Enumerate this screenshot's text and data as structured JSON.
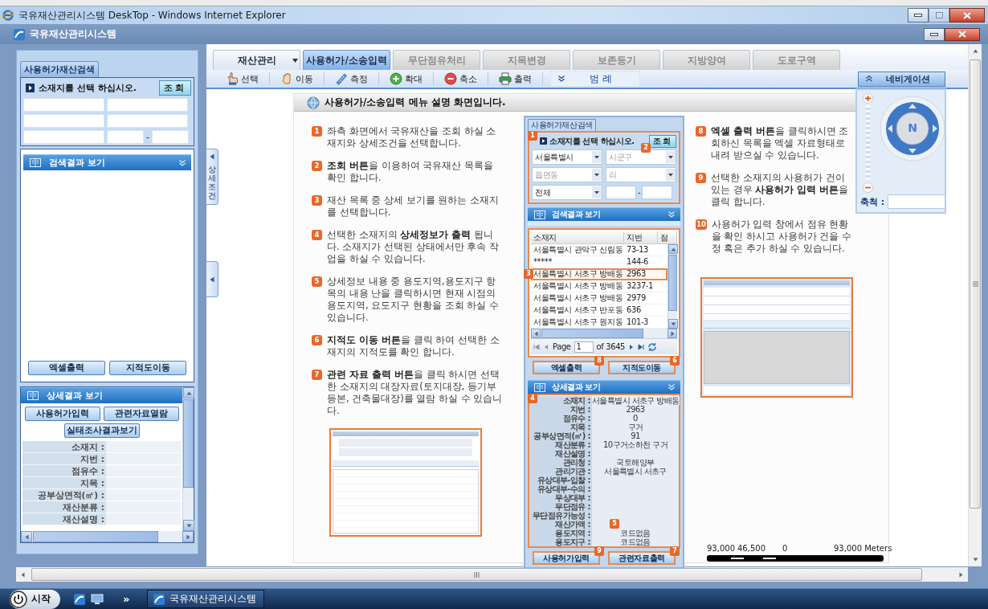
{
  "window": {
    "title": "국유재산관리시스템 DeskTop - Windows Internet Explorer"
  },
  "app": {
    "title": "국유재산관리시스템"
  },
  "search_panel": {
    "tabs": [
      {
        "label": "사용허가재산검색",
        "selected": true
      }
    ],
    "prompt": "소재지를 선택 하십시오.",
    "search_button": "조회",
    "range_separator": "-"
  },
  "results_section": {
    "title": "검색결과 보기",
    "buttons": [
      "엑셀출력",
      "지적도이동"
    ]
  },
  "detail_section": {
    "title": "상세결과 보기",
    "buttons": [
      "사용허가입력",
      "관련자료열람",
      "실태조사결과보기"
    ],
    "fields": [
      "소재지 :",
      "지번 :",
      "점유수 :",
      "지목 :",
      "공부상면적(㎡) :",
      "재산분류 :",
      "재산설명 :"
    ]
  },
  "side_handles": [
    {
      "kind": "labeled",
      "label": "상세조건"
    },
    {
      "kind": "arrow"
    }
  ],
  "tabs": [
    {
      "label": "재산관리",
      "selected": false,
      "disabled": false,
      "dropdown": true
    },
    {
      "label": "사용허가/소송입력",
      "selected": true,
      "disabled": false,
      "dropdown": false
    },
    {
      "label": "무단점유처리",
      "selected": false,
      "disabled": true,
      "dropdown": false
    },
    {
      "label": "지목변경",
      "selected": false,
      "disabled": true,
      "dropdown": false
    },
    {
      "label": "보존등기",
      "selected": false,
      "disabled": true,
      "dropdown": false
    },
    {
      "label": "지방양여",
      "selected": false,
      "disabled": true,
      "dropdown": false
    },
    {
      "label": "도로구역",
      "selected": false,
      "disabled": true,
      "dropdown": false
    }
  ],
  "toolbar": [
    {
      "kind": "select",
      "label": "선택"
    },
    {
      "kind": "pan",
      "label": "이동"
    },
    {
      "kind": "measure",
      "label": "측정"
    },
    {
      "kind": "zoom_in",
      "label": "확대"
    },
    {
      "kind": "zoom_out",
      "label": "축소"
    },
    {
      "kind": "print",
      "label": "출력"
    }
  ],
  "legend": {
    "label": "범 례",
    "expanded": false
  },
  "navigation": {
    "label": "네비게이션",
    "expanded": true,
    "north": "N",
    "scale_label": "축척 :"
  },
  "guide": {
    "title": "사용허가/소송입력 메뉴 설명 화면입니다.",
    "steps_left": [
      {
        "number": "1",
        "text": "좌측 화면에서 국유재산을 조회 하실 소재지와 상세조건을 선택합니다."
      },
      {
        "number": "2",
        "text": "**조회 버튼**을 이용하여 국유재산 목록을 확인 합니다."
      },
      {
        "number": "3",
        "text": "재산 목록 중 상세 보기를 원하는 소재지를 선택합니다."
      },
      {
        "number": "4",
        "text": "선택한 소재지의 **상세정보가 출력** 됩니다. 소재지가 선택된 상태에서만 후속 작업을 하실 수 있습니다."
      },
      {
        "number": "5",
        "text": "상세정보 내용 중 용도지역,용도지구 항목의 내용 난을 클릭하시면 현재 시점의 용도지역, 요도지구 현황을 조회 하실 수 있습니다."
      },
      {
        "number": "6",
        "text": "**지적도 이동 버튼**을 클릭 하여 선택한 소재지의 지적도를 확인 합니다."
      },
      {
        "number": "7",
        "text": "**관련 자료 출력 버튼**을 클릭 하시면 선택한 소재지의 대장자료(토지대장, 등기부등본, 건축물대장)를 열람 하실 수 있습니다."
      }
    ],
    "example_screen": {
      "tab": "사용허가재산검색",
      "prompt": "소재지를 선택 하십시오.",
      "search_callout": "1",
      "search_button": "조회",
      "search_button_callout": "2",
      "selects": [
        {
          "value": "서울특별시"
        },
        {
          "placeholder": "시군구"
        },
        {
          "placeholder": "읍면동"
        },
        {
          "placeholder": "리"
        },
        {
          "value": "전체"
        }
      ],
      "range_separator": "-",
      "results_title": "검색결과 보기",
      "columns": [
        "소재지",
        "지번",
        "점"
      ],
      "rows": [
        {
          "cells": [
            "서울특별시 관악구 신림동",
            "73-13"
          ],
          "selected": false
        },
        {
          "cells": [
            "*****",
            "144-6"
          ],
          "selected": false
        },
        {
          "cells": [
            "서울특별시 서초구 방배동",
            "2963"
          ],
          "selected": true,
          "callout": "3"
        },
        {
          "cells": [
            "서울특별시 서초구 방배동",
            "3237-1"
          ],
          "selected": false
        },
        {
          "cells": [
            "서울특별시 서초구 방배동",
            "2979"
          ],
          "selected": false
        },
        {
          "cells": [
            "서울특별시 서초구 반포동",
            "636"
          ],
          "selected": false
        },
        {
          "cells": [
            "서울특별시 서초구 원지동",
            "101-3"
          ],
          "selected": false
        }
      ],
      "pager": {
        "label": "Page",
        "page": "1",
        "total": "of 3645"
      },
      "result_buttons": [
        {
          "label": "엑셀출력",
          "callout": "8"
        },
        {
          "label": "지적도이동",
          "callout": "6"
        }
      ],
      "detail_title": "상세결과 보기",
      "detail_callout": "4",
      "details": [
        {
          "label": "소재지 :",
          "value": "서울특별시 서초구 방배동"
        },
        {
          "label": "지번 :",
          "value": "2963"
        },
        {
          "label": "점유수 :",
          "value": "0"
        },
        {
          "label": "지목 :",
          "value": "구거"
        },
        {
          "label": "공부상면적(㎡) :",
          "value": "91"
        },
        {
          "label": "재산분류 :",
          "value": "10구거소하천 구거"
        },
        {
          "label": "재산설명 :"
        },
        {
          "label": "관리청 :",
          "value": "국토해양부"
        },
        {
          "label": "관리기관 :",
          "value": "서울특별시 서초구"
        },
        {
          "label": "유상대부-입찰 :"
        },
        {
          "label": "유상대부-수의 :"
        },
        {
          "label": "무상대부 :"
        },
        {
          "label": "무단점유 :"
        },
        {
          "label": "무단점유가능성 :"
        },
        {
          "label": "재산가액 :",
          "callout": "5"
        },
        {
          "label": "용도지역 :",
          "value": "코드없음"
        },
        {
          "label": "용도지구 :",
          "value": "코드없음"
        }
      ],
      "detail_buttons": [
        {
          "label": "사용허가입력",
          "callout": "9"
        },
        {
          "label": "관련자료출력",
          "callout": "7"
        }
      ]
    },
    "steps_right": [
      {
        "number": "8",
        "text": "**엑셀 출력 버튼**을 클릭하시면 조회하신 목록을 엑셀 자료형태로 내려 받으실 수 있습니다."
      },
      {
        "number": "9",
        "text": "선택한 소재지의 사용허가 건이 있는 경우 **사용허가 입력 버튼**을 클릭 합니다."
      },
      {
        "number": "10",
        "text": "사용허가 입력 창에서 점유 현황을 확인 하시고 사용허가 건을 수정 혹은 추가 하실 수 있습니다."
      }
    ]
  },
  "scale_bar": {
    "labels": [
      "93,000",
      "46,500",
      "0",
      "93,000 Meters"
    ]
  },
  "taskbar": {
    "start": "시작",
    "overflow": "»",
    "tasks": [
      {
        "label": "국유재산관리시스템"
      }
    ]
  }
}
